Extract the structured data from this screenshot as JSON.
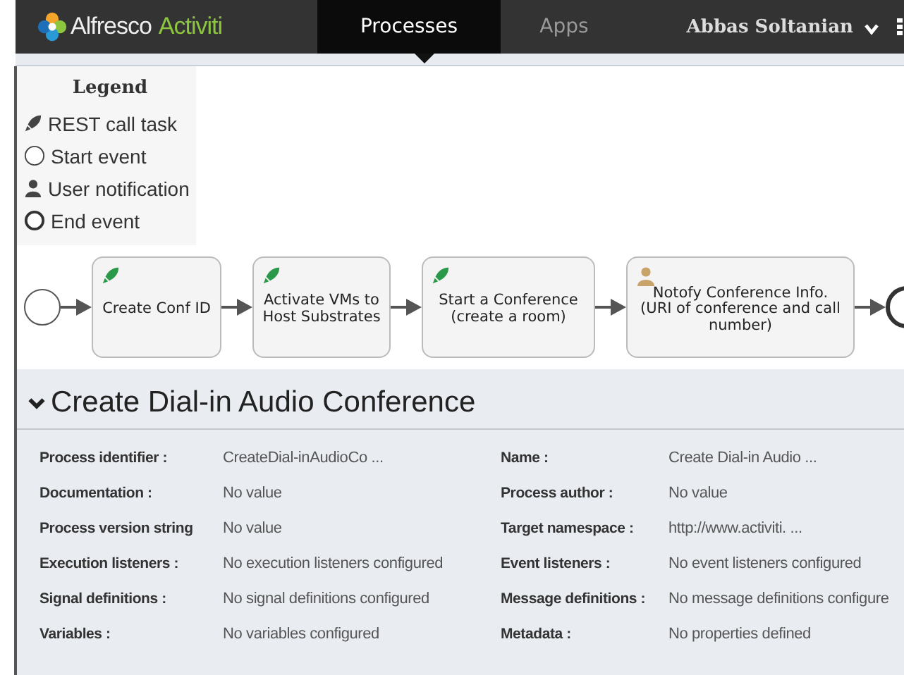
{
  "nav": {
    "logo": {
      "word1": "Alfresco",
      "word2": "Activiti"
    },
    "tabs": [
      {
        "label": "Processes",
        "selected": true
      },
      {
        "label": "Apps",
        "selected": false
      }
    ],
    "user": "Abbas Soltanian"
  },
  "legend": {
    "title": "Legend",
    "items": [
      {
        "kind": "rest",
        "label": "REST call task"
      },
      {
        "kind": "start",
        "label": "Start event"
      },
      {
        "kind": "user",
        "label": "User notification"
      },
      {
        "kind": "end",
        "label": "End event"
      }
    ]
  },
  "diagram": {
    "nodes": [
      {
        "kind": "start"
      },
      {
        "kind": "rest",
        "label": "Create Conf ID"
      },
      {
        "kind": "rest",
        "label": "Activate VMs to\nHost Substrates"
      },
      {
        "kind": "rest",
        "label": "Start a Conference\n(create a room)"
      },
      {
        "kind": "user",
        "label": "Notofy Conference Info.\n(URI of conference and call\nnumber)"
      },
      {
        "kind": "end"
      }
    ]
  },
  "details": {
    "title": "Create Dial-in Audio Conference",
    "expanded": true,
    "rows": [
      {
        "left": {
          "label": "Process identifier :",
          "value": "CreateDial-inAudioCo ..."
        },
        "right": {
          "label": "Name :",
          "value": "Create Dial-in Audio ..."
        }
      },
      {
        "left": {
          "label": "Documentation :",
          "value": "No value"
        },
        "right": {
          "label": "Process author :",
          "value": "No value"
        }
      },
      {
        "left": {
          "label": "Process version string",
          "value": "No value"
        },
        "right": {
          "label": "Target namespace :",
          "value": "http://www.activiti. ..."
        }
      },
      {
        "left": {
          "label": "Execution listeners :",
          "value": "No execution listeners configured"
        },
        "right": {
          "label": "Event listeners :",
          "value": "No event listeners configured"
        }
      },
      {
        "left": {
          "label": "Signal definitions :",
          "value": "No signal definitions configured"
        },
        "right": {
          "label": "Message definitions :",
          "value": "No message definitions configure"
        }
      },
      {
        "left": {
          "label": "Variables :",
          "value": "No variables configured"
        },
        "right": {
          "label": "Metadata :",
          "value": "No properties defined"
        }
      }
    ]
  }
}
